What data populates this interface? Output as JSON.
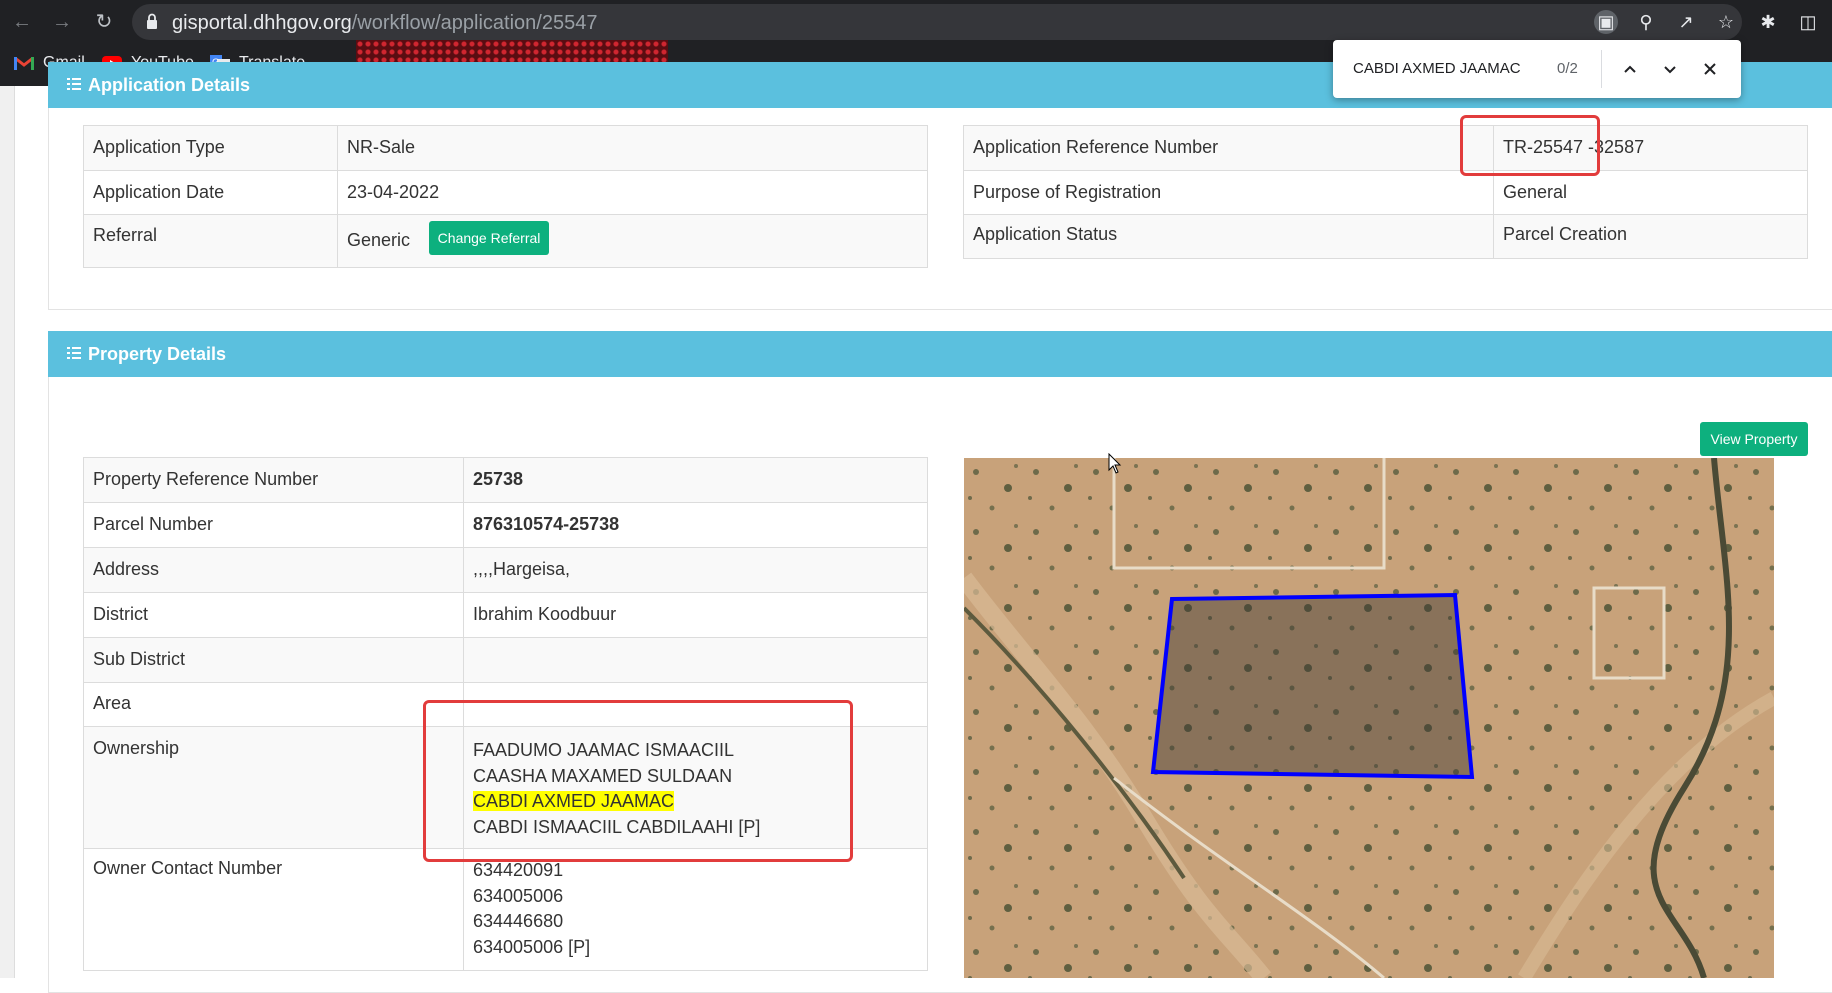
{
  "browser": {
    "url_domain": "gisportal.dhhgov.org",
    "url_path": "/workflow/application/25547",
    "bookmarks": [
      {
        "label": "Gmail",
        "icon": "gmail-icon"
      },
      {
        "label": "YouTube",
        "icon": "youtube-icon"
      },
      {
        "label": "Translate",
        "icon": "translate-icon"
      }
    ]
  },
  "find": {
    "query": "CABDI AXMED JAAMAC",
    "count": "0/2"
  },
  "application_details": {
    "title": "Application Details",
    "left": [
      {
        "label": "Application Type",
        "value": "NR-Sale"
      },
      {
        "label": "Application Date",
        "value": "23-04-2022"
      },
      {
        "label": "Referral",
        "value": "Generic"
      }
    ],
    "change_referral_label": "Change Referral",
    "right": [
      {
        "label": "Application Reference Number",
        "value": "TR-25547 -32587"
      },
      {
        "label": "Purpose of Registration",
        "value": "General"
      },
      {
        "label": "Application Status",
        "value": "Parcel Creation"
      }
    ]
  },
  "property_details": {
    "title": "Property Details",
    "view_property_label": "View Property",
    "rows": [
      {
        "label": "Property Reference Number",
        "value": "25738"
      },
      {
        "label": "Parcel Number",
        "value": "876310574-25738"
      },
      {
        "label": "Address",
        "value": ",,,,Hargeisa,"
      },
      {
        "label": "District",
        "value": "Ibrahim Koodbuur"
      },
      {
        "label": "Sub District",
        "value": ""
      },
      {
        "label": "Area",
        "value": ""
      },
      {
        "label": "Ownership",
        "values": [
          "FAADUMO JAAMAC ISMAACIIL",
          "CAASHA MAXAMED SULDAAN",
          "CABDI AXMED JAAMAC",
          "CABDI ISMAACIIL CABDILAAHI [P]"
        ]
      },
      {
        "label": "Owner Contact Number",
        "values": [
          "634420091",
          "634005006",
          "634446680",
          "634005006 [P]"
        ]
      }
    ]
  },
  "colors": {
    "panel_header": "#5bc0de",
    "button_green": "#0db07e",
    "annotation_red": "#e23c3c",
    "parcel_outline": "#0000ff",
    "find_highlight": "#ffff00"
  }
}
